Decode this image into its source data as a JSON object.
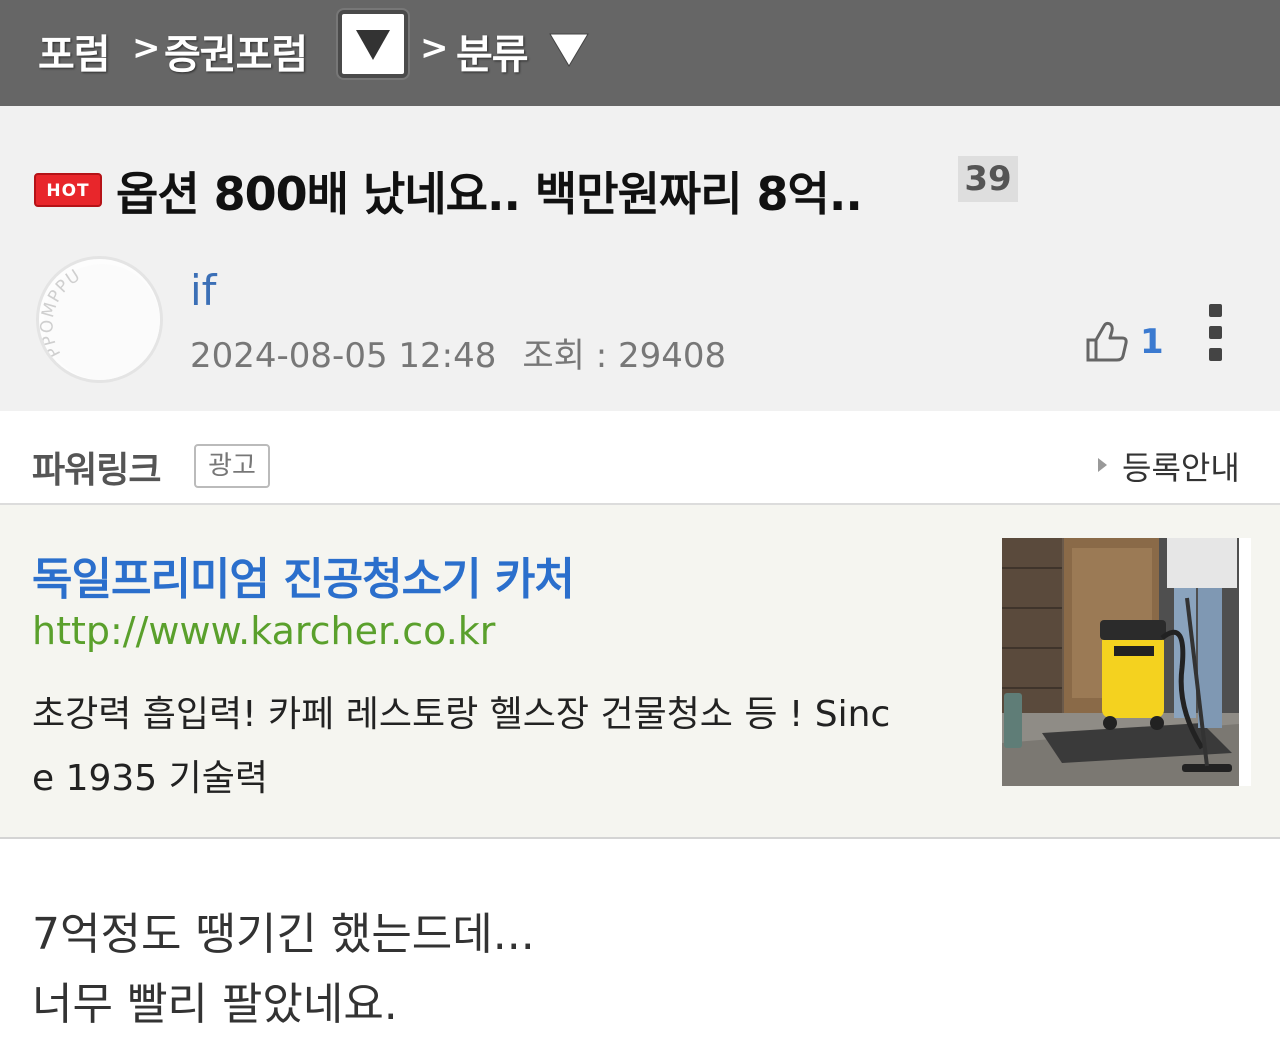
{
  "breadcrumb": {
    "forum": "포럼",
    "separator": ">",
    "board": "증권포럼",
    "category": "분류"
  },
  "post": {
    "badge": "HOT",
    "title": "옵션 800배 났네요.. 백만원짜리 8억..",
    "comment_count": "39",
    "author": "if",
    "datetime": "2024-08-05 12:48",
    "views_label": "조회 : 29408",
    "likes": "1"
  },
  "avatar": {
    "text": "PPOMPPU"
  },
  "powerlink": {
    "title": "파워링크",
    "ad_badge": "광고",
    "register_label": "등록안내"
  },
  "ad": {
    "title": "독일프리미엄 진공청소기 카처",
    "url": "http://www.karcher.co.kr",
    "desc_line1": "초강력 흡입력! 카페 레스토랑 헬스장 건물청소 등 ! Sinc",
    "desc_line2": "e 1935 기술력"
  },
  "content": {
    "line1": "7억정도 땡기긴 했는드데...",
    "line2": "너무 빨리 팔았네요."
  },
  "colors": {
    "topbar": "#666666",
    "hot": "#e8262b",
    "author_link": "#3b6fb6",
    "ad_title": "#2b6fcc",
    "ad_url": "#5aa02c",
    "like": "#3b7ad0"
  },
  "icons": [
    "dropdown-arrow-icon",
    "thumbs-up-icon",
    "more-vertical-icon",
    "triangle-right-icon"
  ]
}
